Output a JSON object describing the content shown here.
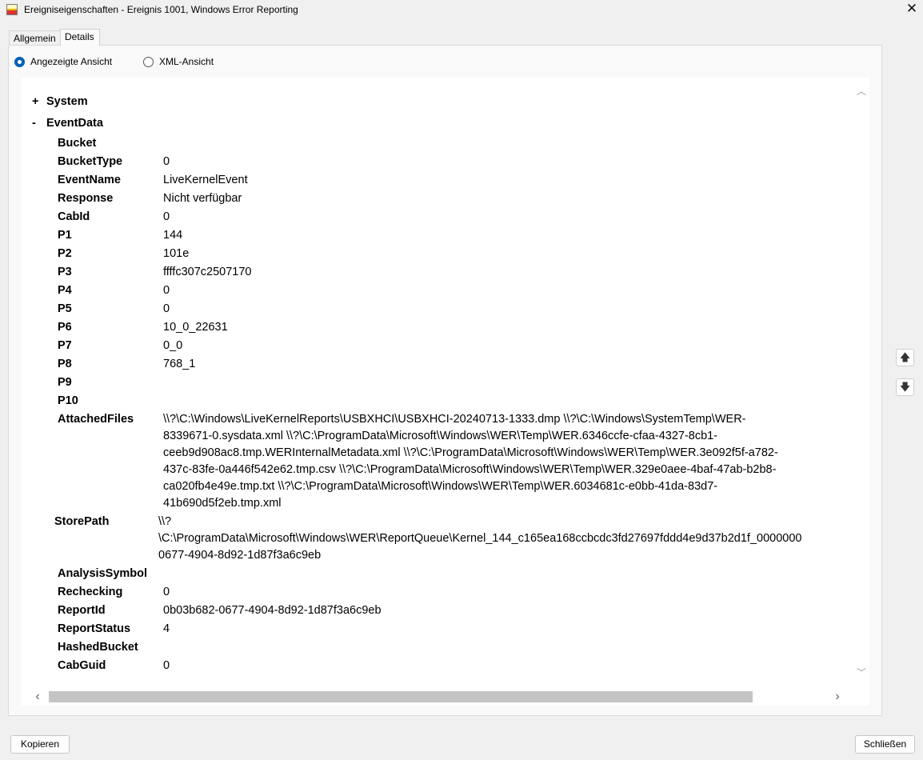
{
  "window": {
    "title": "Ereigniseigenschaften - Ereignis 1001, Windows Error Reporting",
    "icon": "event-viewer-icon",
    "close_glyph": "✕"
  },
  "tabs": [
    {
      "label": "Allgemein",
      "active": false
    },
    {
      "label": "Details",
      "active": true
    }
  ],
  "view_mode": {
    "options": [
      {
        "label": "Angezeigte Ansicht",
        "checked": true
      },
      {
        "label": "XML-Ansicht",
        "checked": false
      }
    ]
  },
  "tree": {
    "system": {
      "toggle": "+",
      "label": "System"
    },
    "event_data": {
      "toggle": "-",
      "label": "EventData"
    },
    "fields": [
      {
        "key": "Bucket",
        "value": ""
      },
      {
        "key": "BucketType",
        "value": "0"
      },
      {
        "key": "EventName",
        "value": "LiveKernelEvent"
      },
      {
        "key": "Response",
        "value": "Nicht verfügbar"
      },
      {
        "key": "CabId",
        "value": "0"
      },
      {
        "key": "P1",
        "value": "144"
      },
      {
        "key": "P2",
        "value": "101e"
      },
      {
        "key": "P3",
        "value": "ffffc307c2507170"
      },
      {
        "key": "P4",
        "value": "0"
      },
      {
        "key": "P5",
        "value": "0"
      },
      {
        "key": "P6",
        "value": "10_0_22631"
      },
      {
        "key": "P7",
        "value": "0_0"
      },
      {
        "key": "P8",
        "value": "768_1"
      },
      {
        "key": "P9",
        "value": ""
      },
      {
        "key": "P10",
        "value": ""
      }
    ],
    "attached_files": {
      "key": "AttachedFiles",
      "lines": [
        "\\\\?\\C:\\Windows\\LiveKernelReports\\USBXHCI\\USBXHCI-20240713-1333.dmp \\\\?\\C:\\Windows\\SystemTemp\\WER-",
        "8339671-0.sysdata.xml \\\\?\\C:\\ProgramData\\Microsoft\\Windows\\WER\\Temp\\WER.6346ccfe-cfaa-4327-8cb1-",
        "ceeb9d908ac8.tmp.WERInternalMetadata.xml \\\\?\\C:\\ProgramData\\Microsoft\\Windows\\WER\\Temp\\WER.3e092f5f-a782-",
        "437c-83fe-0a446f542e62.tmp.csv \\\\?\\C:\\ProgramData\\Microsoft\\Windows\\WER\\Temp\\WER.329e0aee-4baf-47ab-b2b8-",
        "ca020fb4e49e.tmp.txt \\\\?\\C:\\ProgramData\\Microsoft\\Windows\\WER\\Temp\\WER.6034681c-e0bb-41da-83d7-",
        "41b690d5f2eb.tmp.xml"
      ]
    },
    "store_path": {
      "key": "StorePath",
      "lines": [
        "\\\\?",
        "\\C:\\ProgramData\\Microsoft\\Windows\\WER\\ReportQueue\\Kernel_144_c165ea168ccbcdc3fd27697fddd4e9d37b2d1f_0000000",
        "0677-4904-8d92-1d87f3a6c9eb"
      ]
    },
    "fields_after": [
      {
        "key": "AnalysisSymbol",
        "value": ""
      },
      {
        "key": "Rechecking",
        "value": "0"
      },
      {
        "key": "ReportId",
        "value": "0b03b682-0677-4904-8d92-1d87f3a6c9eb"
      },
      {
        "key": "ReportStatus",
        "value": "4"
      },
      {
        "key": "HashedBucket",
        "value": ""
      },
      {
        "key": "CabGuid",
        "value": "0"
      }
    ]
  },
  "scrollbars": {
    "up_glyph": "︿",
    "down_glyph": "﹀",
    "left_glyph": "‹",
    "right_glyph": "›",
    "horizontal_position": 0.0,
    "vertical_position": 0.0
  },
  "side_buttons": {
    "up_icon": "arrow-up-icon",
    "down_icon": "arrow-down-icon",
    "up_glyph": "🡅",
    "down_glyph": "🡇"
  },
  "footer": {
    "copy_label": "Kopieren",
    "close_label": "Schließen"
  }
}
